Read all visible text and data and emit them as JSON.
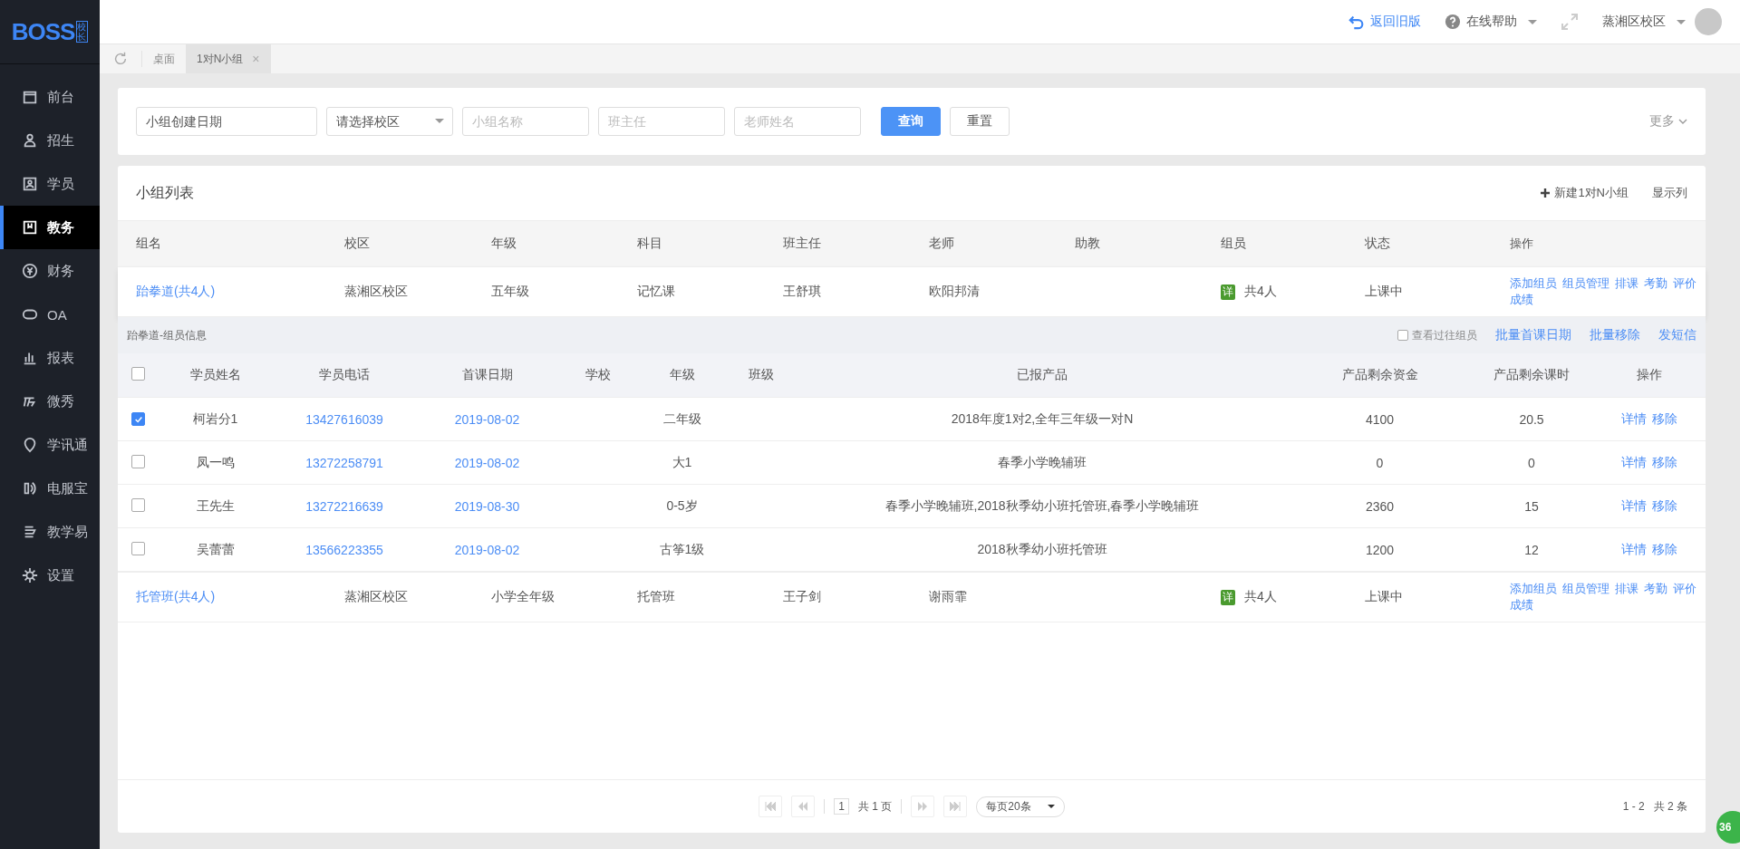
{
  "logo": {
    "text": "BOSS",
    "sub": "校长"
  },
  "sidebar": {
    "items": [
      {
        "label": "前台",
        "selected": false
      },
      {
        "label": "招生",
        "selected": false
      },
      {
        "label": "学员",
        "selected": false
      },
      {
        "label": "教务",
        "selected": true
      },
      {
        "label": "财务",
        "selected": false
      },
      {
        "label": "OA",
        "selected": false
      },
      {
        "label": "报表",
        "selected": false
      },
      {
        "label": "微秀",
        "selected": false
      },
      {
        "label": "学讯通",
        "selected": false
      },
      {
        "label": "电服宝",
        "selected": false
      },
      {
        "label": "教学易",
        "selected": false
      },
      {
        "label": "设置",
        "selected": false
      }
    ]
  },
  "topbar": {
    "back_link": "返回旧版",
    "help": "在线帮助",
    "campus": "蒸湘区校区"
  },
  "tabs": [
    {
      "label": "桌面",
      "selected": false
    },
    {
      "label": "1对N小组",
      "selected": true,
      "close": "×"
    }
  ],
  "filters": {
    "fields": [
      {
        "kind": "date",
        "placeholder": "小组创建日期"
      },
      {
        "kind": "select",
        "placeholder": "请选择校区"
      },
      {
        "kind": "text",
        "placeholder": "小组名称"
      },
      {
        "kind": "text",
        "placeholder": "班主任"
      },
      {
        "kind": "text",
        "placeholder": "老师姓名"
      }
    ],
    "search_button": "查询",
    "reset_button": "重置",
    "more": "更多"
  },
  "group_list": {
    "title": "小组列表",
    "new_button": "新建1对N小组",
    "columns_button": "显示列",
    "columns": [
      "组名",
      "校区",
      "年级",
      "科目",
      "班主任",
      "老师",
      "助教",
      "组员",
      "状态",
      "操作"
    ],
    "groups": [
      {
        "name": "跆拳道(共4人)",
        "campus": "蒸湘区校区",
        "grade": "五年级",
        "subject": "记忆课",
        "head_teacher": "王舒琪",
        "teacher": "欧阳邦清",
        "member_badge": "详",
        "members": "共4人",
        "status": "上课中",
        "actions": [
          "添加组员",
          "组员管理",
          "排课",
          "考勤",
          "评价",
          "成绩"
        ],
        "expanded": true,
        "detail": {
          "title": "跆拳道-组员信息",
          "history": {
            "label": "查看过往组员",
            "checked": false
          },
          "links": [
            "批量首课日期",
            "批量移除",
            "发短信"
          ],
          "select_all_checked": false,
          "columns": [
            "学员姓名",
            "学员电话",
            "首课日期",
            "学校",
            "年级",
            "班级",
            "已报产品",
            "产品剩余资金",
            "产品剩余课时",
            "操作"
          ],
          "rows": [
            {
              "checked": true,
              "name": "柯岩分1",
              "phone": "13427616039",
              "first_date": "2019-08-02",
              "grade": "二年级",
              "product": "2018年度1对2,全年三年级一对N",
              "fund": "4100",
              "hours": "20.5",
              "actions": [
                "详情",
                "移除"
              ]
            },
            {
              "checked": false,
              "name": "凤一鸣",
              "phone": "13272258791",
              "first_date": "2019-08-02",
              "grade": "大1",
              "product": "春季小学晚辅班",
              "fund": "0",
              "hours": "0",
              "actions": [
                "详情",
                "移除"
              ]
            },
            {
              "checked": false,
              "name": "王先生",
              "phone": "13272216639",
              "first_date": "2019-08-30",
              "grade": "0-5岁",
              "product": "春季小学晚辅班,2018秋季幼小班托管班,春季小学晚辅班",
              "fund": "2360",
              "hours": "15",
              "actions": [
                "详情",
                "移除"
              ]
            },
            {
              "checked": false,
              "name": "吴蕾蕾",
              "phone": "13566223355",
              "first_date": "2019-08-02",
              "grade": "古筝1级",
              "product": "2018秋季幼小班托管班",
              "fund": "1200",
              "hours": "12",
              "actions": [
                "详情",
                "移除"
              ]
            }
          ]
        }
      },
      {
        "name": "托管班(共4人)",
        "campus": "蒸湘区校区",
        "grade": "小学全年级",
        "subject": "托管班",
        "head_teacher": "王子剑",
        "teacher": "谢雨霏",
        "member_badge": "详",
        "members": "共4人",
        "status": "上课中",
        "actions": [
          "添加组员",
          "组员管理",
          "排课",
          "考勤",
          "评价",
          "成绩"
        ],
        "expanded": false
      }
    ]
  },
  "pagination": {
    "page": "1",
    "total_pages": "共 1 页",
    "page_size": "每页20条",
    "range": "1 - 2",
    "total": "共 2 条"
  },
  "floating_badge": "36"
}
